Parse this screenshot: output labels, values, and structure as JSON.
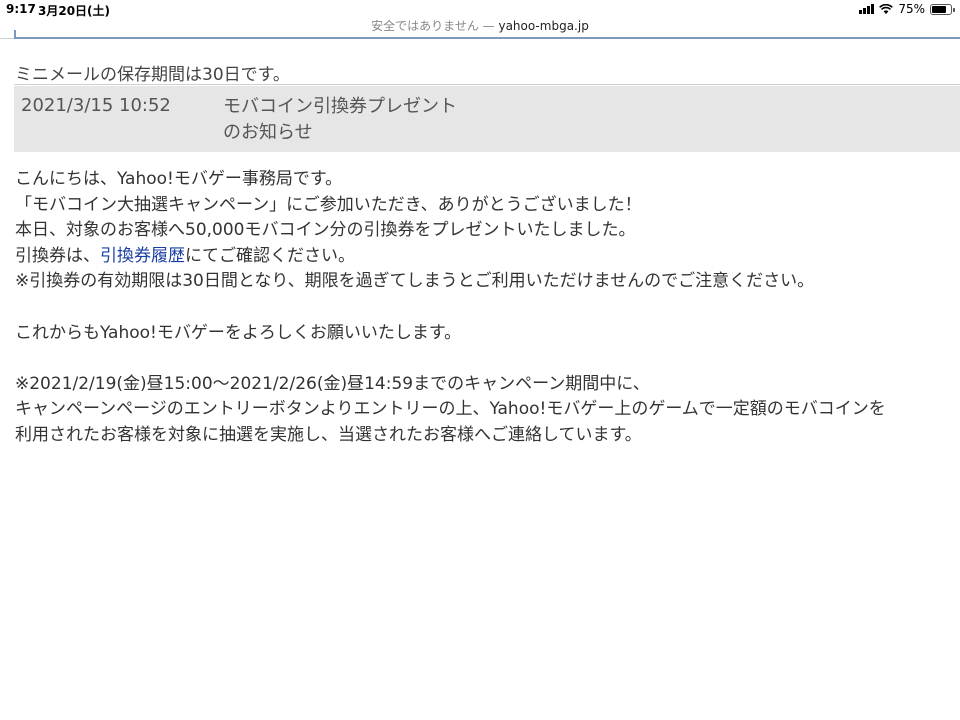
{
  "status_bar": {
    "time": "9:17",
    "date": "3月20日(土)",
    "battery": "75%",
    "battery_level": 0.75,
    "signal_icon": "cellular-signal-icon",
    "wifi_icon": "wifi-icon",
    "battery_icon": "battery-icon"
  },
  "url_bar": {
    "security_label": "安全ではありません —",
    "domain": "yahoo-mbga.jp"
  },
  "notice": "ミニメールの保存期間は30日です。",
  "message": {
    "date": "2021/3/15 10:52",
    "title": "モバコイン引換券プレゼントのお知らせ",
    "body": {
      "line1": "こんにちは、Yahoo!モバゲー事務局です。",
      "line2": "「モバコイン大抽選キャンペーン」にご参加いただき、ありがとうございました！",
      "line3": "本日、対象のお客様へ50,000モバコイン分の引換券をプレゼントいたしました。",
      "line4_prefix": "引換券は、",
      "line4_link": "引換券履歴",
      "line4_suffix": "にてご確認ください。",
      "line5": "※引換券の有効期限は30日間となり、期限を過ぎてしまうとご利用いただけませんのでご注意ください。",
      "line6": "これからもYahoo!モバゲーをよろしくお願いいたします。",
      "line7": "※2021/2/19(金)昼15:00～2021/2/26(金)昼14:59までのキャンペーン期間中に、",
      "line8": "キャンペーンページのエントリーボタンよりエントリーの上、Yahoo!モバゲー上のゲームで一定額のモバコインを",
      "line9": "利用されたお客様を対象に抽選を実施し、当選されたお客様へご連絡しています。"
    }
  },
  "colors": {
    "link": "#1a3fa4",
    "header_bg": "#e6e6e6",
    "frame_border": "#7a99bf"
  }
}
